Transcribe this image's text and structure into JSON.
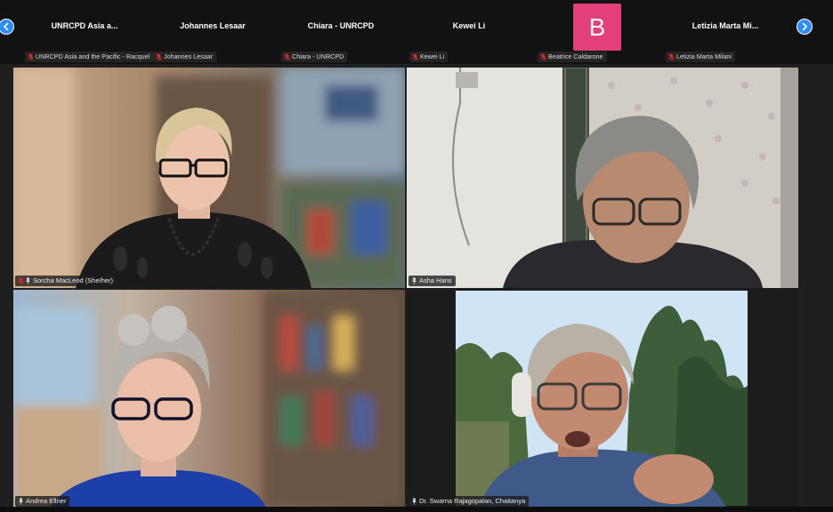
{
  "strip": {
    "participants": [
      {
        "display": "UNRCPD Asia a...",
        "tag": "UNRCPD Asia and the Pacific - Racquel",
        "muted": true
      },
      {
        "display": "Johannes Lesaar",
        "tag": "Johannes Lesaar",
        "muted": true
      },
      {
        "display": "Chiara - UNRCPD",
        "tag": "Chiara - UNRCPD",
        "muted": true
      },
      {
        "display": "Kewei Li",
        "tag": "Kewei Li",
        "muted": true
      },
      {
        "display": "B",
        "tag": "Beatrice Caldarone",
        "muted": true,
        "avatar_color": "#e2407a"
      },
      {
        "display": "Letizia Marta Mi...",
        "tag": "Letizia Marta Milani",
        "muted": true
      }
    ]
  },
  "grid": {
    "tiles": [
      {
        "name": "Sorcha MacLeod (She/her)",
        "muted": true,
        "pinned": true,
        "speaking": false
      },
      {
        "name": "Asha Hans",
        "muted": false,
        "pinned": true,
        "speaking": false
      },
      {
        "name": "Andrea Ellner",
        "muted": false,
        "pinned": true,
        "speaking": false
      },
      {
        "name": "Dr. Swarna Rajagopalan, Chaitanya",
        "muted": false,
        "pinned": true,
        "speaking": true
      }
    ]
  },
  "colors": {
    "accent": "#2d8cff",
    "speaking": "#3fd98a",
    "muted_red": "#e02828"
  },
  "icons": [
    "chevron-left-icon",
    "chevron-right-icon",
    "mic-muted-icon",
    "pin-icon"
  ]
}
